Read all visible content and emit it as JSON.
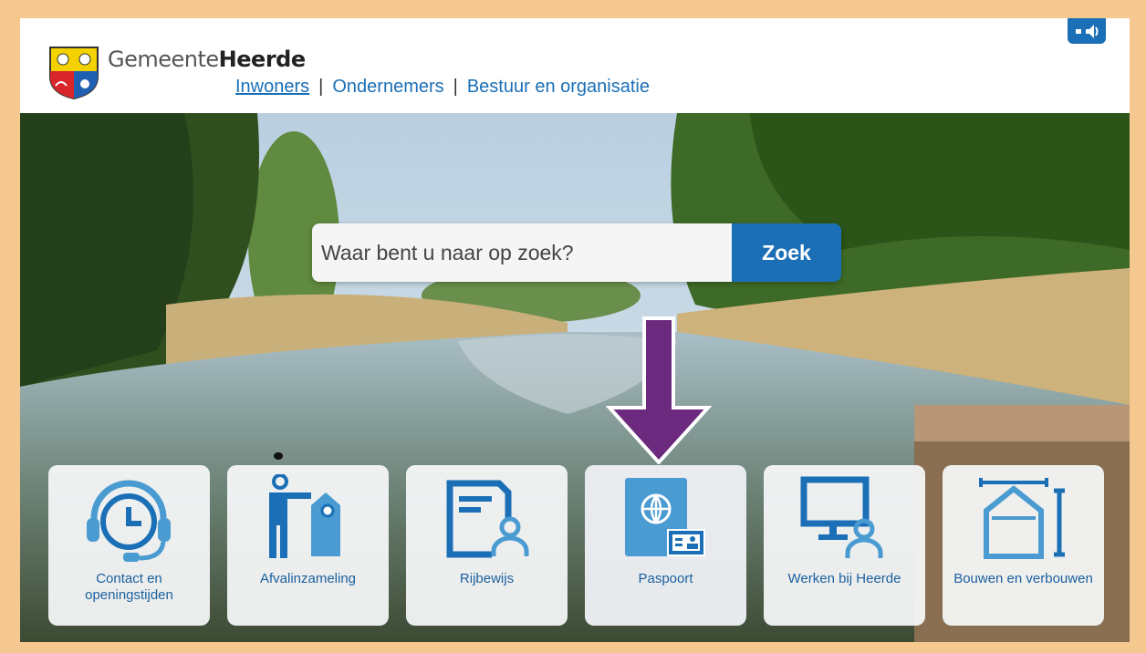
{
  "header": {
    "brand_prefix": "Gemeente",
    "brand_name": "Heerde",
    "nav": [
      {
        "label": "Inwoners",
        "active": true
      },
      {
        "label": "Ondernemers",
        "active": false
      },
      {
        "label": "Bestuur en organisatie",
        "active": false
      }
    ],
    "separator": "|"
  },
  "search": {
    "placeholder": "Waar bent u naar op zoek?",
    "button_label": "Zoek"
  },
  "tiles": [
    {
      "label": "Contact en openingstijden",
      "icon": "headset-clock-icon"
    },
    {
      "label": "Afvalinzameling",
      "icon": "person-waste-bag-icon"
    },
    {
      "label": "Rijbewijs",
      "icon": "driving-license-icon"
    },
    {
      "label": "Paspoort",
      "icon": "passport-icon"
    },
    {
      "label": "Werken bij Heerde",
      "icon": "computer-user-icon"
    },
    {
      "label": "Bouwen en verbouwen",
      "icon": "house-measure-icon"
    }
  ],
  "colors": {
    "brand_blue": "#1b6fb6",
    "frame": "#f5c88f",
    "arrow": "#6b2a7d"
  }
}
